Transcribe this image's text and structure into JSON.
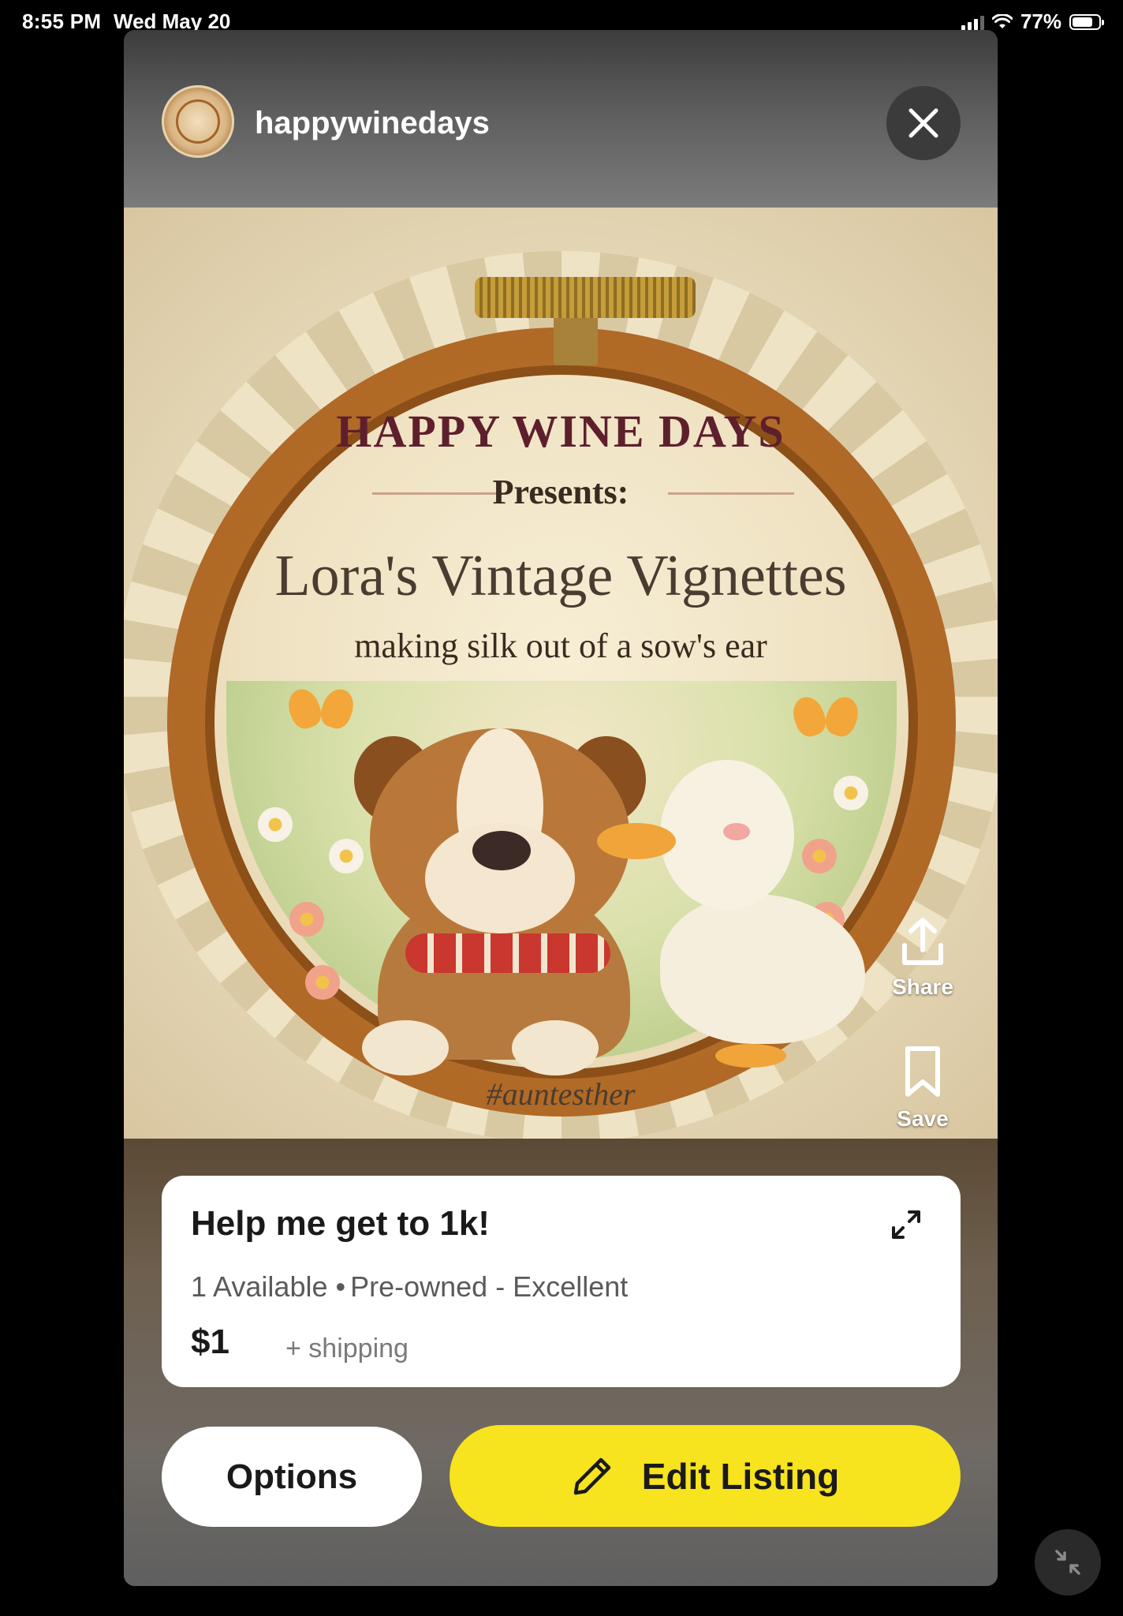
{
  "status_bar": {
    "time": "8:55 PM",
    "date": "Wed May 20",
    "battery": "77%",
    "battery_level": 0.77
  },
  "header": {
    "username": "happywinedays",
    "avatar_icon": "profile-avatar"
  },
  "artwork": {
    "brand_line": "HAPPY WINE DAYS",
    "presents": "Presents:",
    "main_title": "Lora's Vintage Vignettes",
    "tagline": "making silk out of a sow's ear",
    "hashtag": "#auntesther"
  },
  "side_actions": {
    "share_label": "Share",
    "save_label": "Save"
  },
  "listing": {
    "title": "Help me get to 1k!",
    "availability": "1 Available",
    "condition": "Pre-owned - Excellent",
    "price": "$1",
    "shipping": "+ shipping"
  },
  "buttons": {
    "options_label": "Options",
    "edit_label": "Edit Listing"
  },
  "colors": {
    "edit_button": "#f7e31e",
    "card_bg": "#ffffff"
  }
}
